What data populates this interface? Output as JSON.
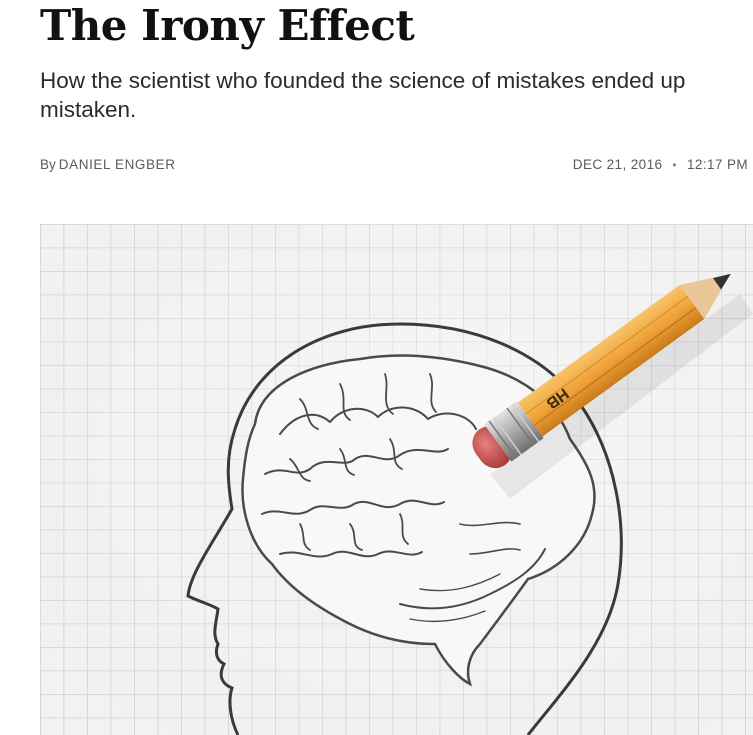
{
  "article": {
    "headline": "The Irony Effect",
    "dek": "How the scientist who founded the science of mistakes ended up mistaken.",
    "byline_prefix": "By",
    "author": "DANIEL ENGBER",
    "date": "DEC 21, 2016",
    "separator": "•",
    "time": "12:17 PM"
  },
  "hero_image": {
    "subject": "pencil-erasing-brain-illustration",
    "pencil_label": "HB",
    "colors": {
      "grid_bg": "#f2f2f2",
      "grid_line": "#cfcfcf",
      "pencil_body": "#f0a43a",
      "eraser": "#c94a4a",
      "ferrule": "#b8b8b8"
    }
  }
}
